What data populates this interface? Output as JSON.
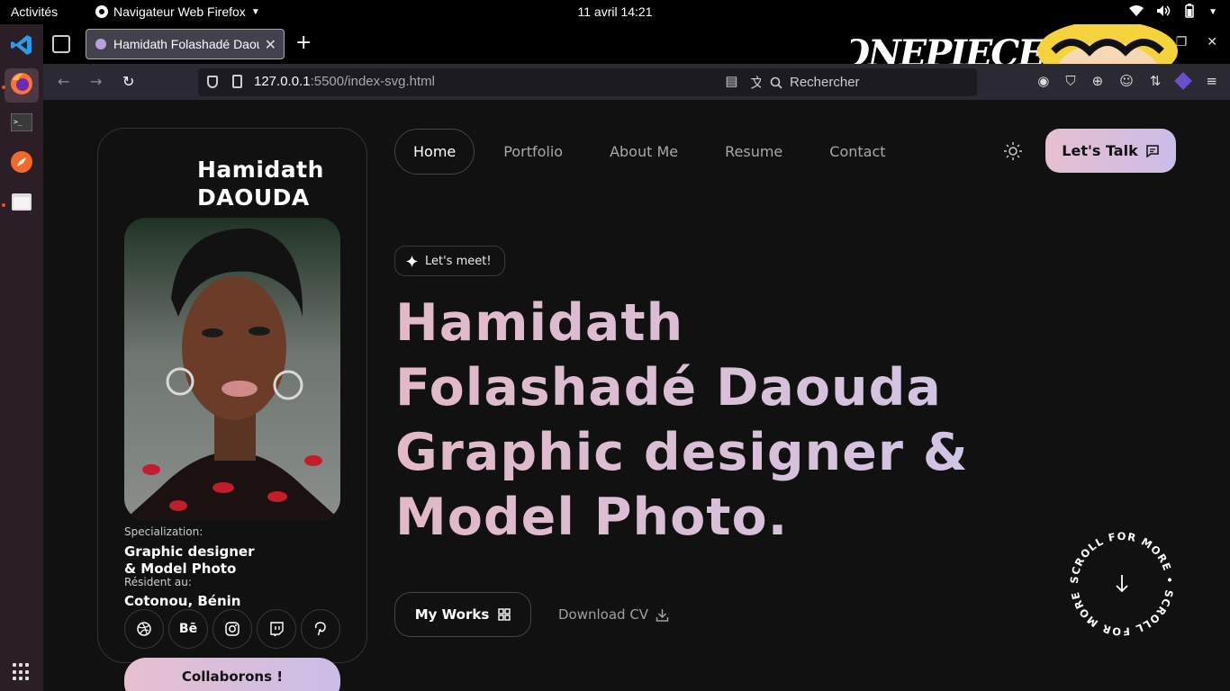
{
  "system": {
    "activities": "Activités",
    "app_name": "Navigateur Web Firefox",
    "clock": "11 avril  14:21"
  },
  "browser": {
    "tab_title": "Hamidath Folashadé Daouda",
    "url_host": "127.0.0.1",
    "url_path": ":5500/index-svg.html",
    "search_placeholder": "Rechercher",
    "banner_logo": "ONEPIECE"
  },
  "profile": {
    "name_first": "Hamidath",
    "name_last": "DAOUDA",
    "specialization_label": "Specialization:",
    "specialization_line1": "Graphic designer",
    "specialization_line2": "& Model Photo",
    "resident_label": "Résident au:",
    "resident_value": "Cotonou, Bénin",
    "socials": [
      "dribbble-icon",
      "behance-icon",
      "instagram-icon",
      "twitch-icon",
      "pinterest-icon"
    ],
    "behance_label": "Bē",
    "collab_label": "Collaborons !"
  },
  "menu": {
    "items": [
      "Home",
      "Portfolio",
      "About Me",
      "Resume",
      "Contact"
    ],
    "talk_label": "Let's Talk"
  },
  "hero": {
    "badge": "Let's meet!",
    "lines": [
      "Hamidath",
      "Folashadé Daouda",
      "Graphic designer &",
      "Model Photo."
    ],
    "works_label": "My Works",
    "cv_label": "Download CV",
    "scroll_text": "SCROLL FOR MORE • SCROLL FOR MORE •"
  },
  "colors": {
    "accent_start": "#e2b9c8",
    "accent_end": "#cfc6ea",
    "background": "#111111"
  }
}
